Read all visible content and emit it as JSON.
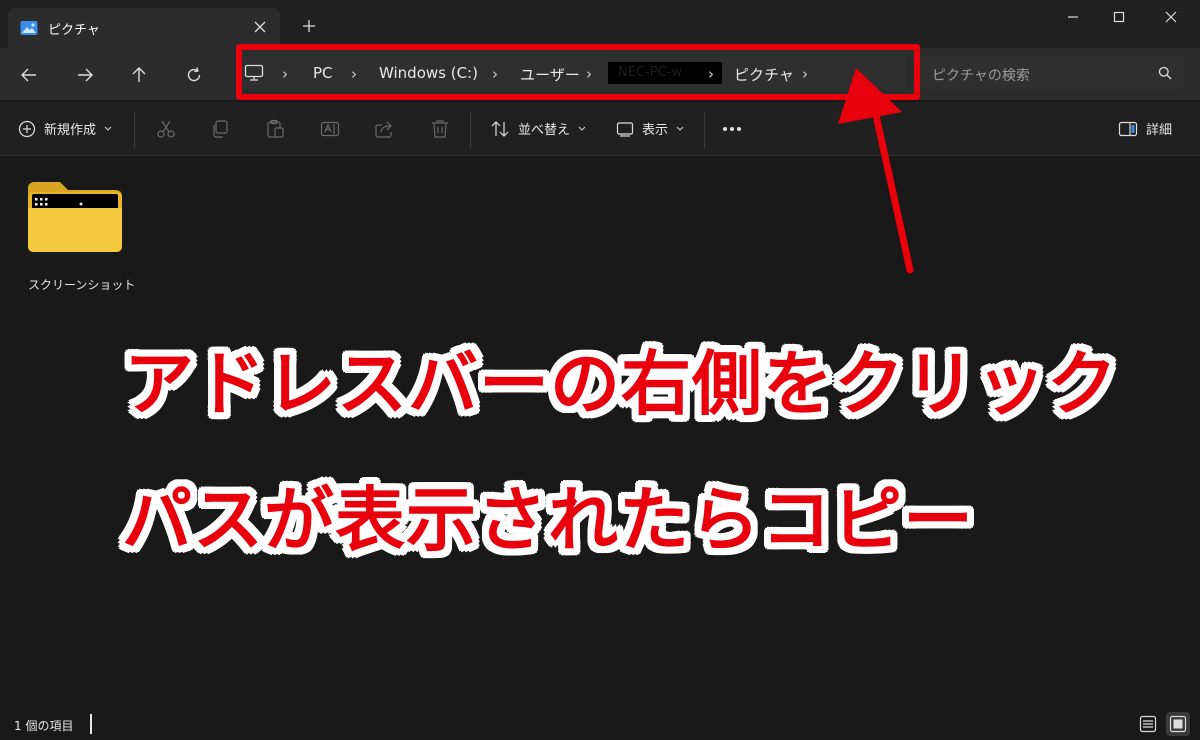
{
  "tab": {
    "title": "ピクチャ"
  },
  "address": {
    "segments": [
      "PC",
      "Windows (C:)",
      "ユーザー",
      "NEC-PC-w",
      "ピクチャ"
    ]
  },
  "search": {
    "placeholder": "ピクチャの検索"
  },
  "toolbar": {
    "new_label": "新規作成",
    "sort_label": "並べ替え",
    "view_label": "表示",
    "details_label": "詳細"
  },
  "content": {
    "items": [
      {
        "name": "スクリーンショット",
        "type": "folder"
      }
    ]
  },
  "annotation": {
    "line1": "アドレスバーの右側をクリック",
    "line2": "パスが表示されたらコピー",
    "color": "#e8000c"
  },
  "status": {
    "count": "1 個の項目"
  }
}
